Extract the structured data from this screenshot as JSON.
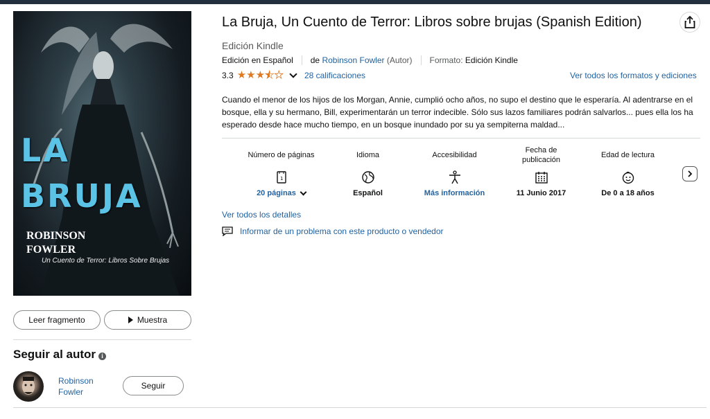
{
  "book": {
    "title": "La Bruja, Un Cuento de Terror: Libros sobre brujas (Spanish Edition)",
    "edition": "Edición Kindle",
    "language_line": "Edición en Español",
    "by_prefix": "de",
    "author": "Robinson Fowler",
    "author_role": "(Autor)",
    "format_label": "Formato:",
    "format_value": "Edición Kindle",
    "rating": "3.3",
    "rating_stars": 3.3,
    "ratings_count": "28 calificaciones",
    "all_formats": "Ver todos los formatos y ediciones",
    "description": "Cuando el menor de los hijos de los Morgan, Annie, cumplió ocho años, no supo el destino que le esperaría. Al adentrarse en el bosque, ella y su hermano, Bill, experimentarán un terror indecible. Sólo sus lazos familiares podrán salvarlos... pues ella los ha esperado desde hace mucho tiempo, en un bosque inundado por su ya sempiterna maldad..."
  },
  "cover": {
    "title_line1": "LA",
    "title_line2": "BRUJA",
    "author_line1": "ROBINSON",
    "author_line2": "FOWLER",
    "subtitle": "Un Cuento de Terror: Libros Sobre Brujas"
  },
  "buttons": {
    "read": "Leer fragmento",
    "sample": "Muestra",
    "follow": "Seguir"
  },
  "follow_section": {
    "title": "Seguir al autor",
    "author_line1": "Robinson",
    "author_line2": "Fowler"
  },
  "attributes": [
    {
      "label": "Número de páginas",
      "value": "20 páginas",
      "icon": "pages-icon"
    },
    {
      "label": "Idioma",
      "value": "Español",
      "icon": "globe-icon"
    },
    {
      "label": "Accesibilidad",
      "value": "Más información",
      "icon": "accessibility-icon"
    },
    {
      "label": "Fecha de publicación",
      "value": "11 Junio 2017",
      "icon": "calendar-icon"
    },
    {
      "label": "Edad de lectura",
      "value": "De 0 a 18 años",
      "icon": "child-face-icon"
    }
  ],
  "links": {
    "details": "Ver todos los detalles",
    "report": "Informar de un problema con este producto o vendedor"
  },
  "colors": {
    "link": "#2162a1",
    "star": "#de7921",
    "cover_title": "#5bc4e6"
  }
}
